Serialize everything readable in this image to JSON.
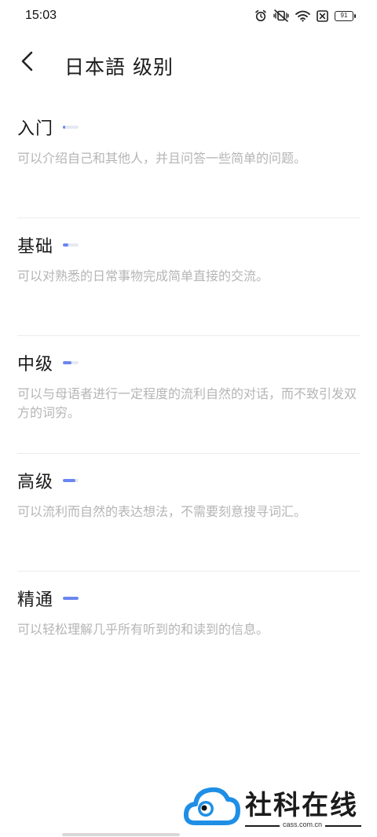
{
  "status_bar": {
    "time": "15:03",
    "battery": "91"
  },
  "header": {
    "title": "日本語 级别"
  },
  "levels": [
    {
      "name": "入门",
      "progress": 0.15,
      "description": "可以介绍自己和其他人，并且问答一些简单的问题。"
    },
    {
      "name": "基础",
      "progress": 0.35,
      "description": "可以对熟悉的日常事物完成简单直接的交流。"
    },
    {
      "name": "中级",
      "progress": 0.55,
      "description": "可以与母语者进行一定程度的流利自然的对话，而不致引发双方的词穷。"
    },
    {
      "name": "高级",
      "progress": 0.8,
      "description": "可以流利而自然的表达想法，不需要刻意搜寻词汇。"
    },
    {
      "name": "精通",
      "progress": 1.0,
      "description": "可以轻松理解几乎所有听到的和读到的信息。"
    }
  ],
  "watermark": {
    "title": "社科在线",
    "url": "cass.com.cn"
  },
  "colors": {
    "accent": "#6b86f0",
    "track": "#e6e9f2",
    "description_text": "#b5b5b5",
    "logo_blue": "#1f8fe6"
  },
  "icons": [
    "alarm-icon",
    "vibrate-icon",
    "wifi-icon",
    "sim-off-icon",
    "battery-icon",
    "back-arrow-icon"
  ]
}
